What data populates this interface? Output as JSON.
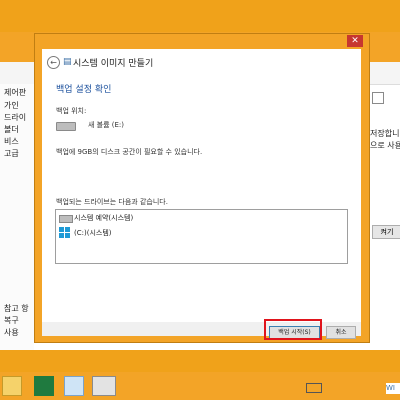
{
  "background_window": {
    "left_lines": [
      "제어판",
      "가인",
      "드라이",
      "볼더",
      "비스",
      "고급"
    ],
    "bottom_left_lines": [
      "참고 항",
      "복구",
      "사용"
    ],
    "right_lines": [
      "저장합니다.",
      "으로 사용"
    ],
    "button_label": "켜기"
  },
  "dialog": {
    "title": "시스템 이미지 만들기",
    "close_glyph": "✕",
    "heading": "백업 설정 확인",
    "location_label": "백업 위치:",
    "drive_name": "새 볼륨 (E:)",
    "space_notice": "백업에 9GB의 디스크 공간이 필요할 수 있습니다.",
    "list_label": "백업되는 드라이브는 다음과 같습니다.",
    "drives": [
      {
        "label": "시스템 예약(시스템)"
      },
      {
        "label": "(C:)(시스템)"
      }
    ],
    "buttons": {
      "start": "백업 시작(S)",
      "cancel": "취소"
    }
  },
  "taskbar": {
    "lang": "WI"
  },
  "colors": {
    "accent": "#f3a427",
    "highlight": "#e0141c",
    "heading": "#1a4f9c"
  }
}
